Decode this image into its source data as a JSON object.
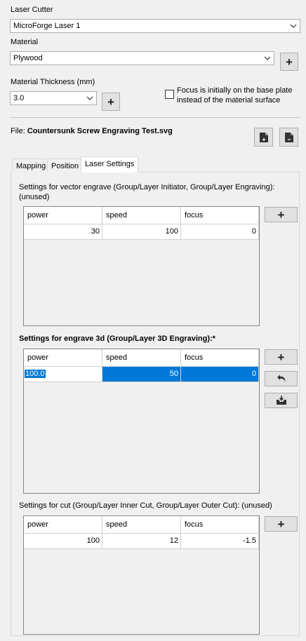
{
  "laser_cutter": {
    "label": "Laser Cutter",
    "value": "MicroForge Laser 1"
  },
  "material": {
    "label": "Material",
    "value": "Plywood"
  },
  "thickness": {
    "label": "Material Thickness (mm)",
    "value": "3.0"
  },
  "focus_option": {
    "line1": "Focus is initially on the base plate",
    "line2": "instead of the material surface",
    "checked": false
  },
  "file": {
    "label": "File:",
    "name": "Countersunk Screw Engraving Test.svg"
  },
  "tabs": [
    {
      "label": "Mapping",
      "active": false
    },
    {
      "label": "Position",
      "active": false
    },
    {
      "label": "Laser Settings",
      "active": true
    }
  ],
  "sections": {
    "vector": {
      "title_line1": "Settings for vector engrave (Group/Layer Initiator, Group/Layer Engraving):",
      "title_line2": "(unused)",
      "columns": [
        "power",
        "speed",
        "focus"
      ],
      "row": [
        "30",
        "100",
        "0"
      ]
    },
    "engrave3d": {
      "title": "Settings for engrave 3d (Group/Layer 3D Engraving):*",
      "columns": [
        "power",
        "speed",
        "focus"
      ],
      "row": [
        "100.0",
        "50",
        "0"
      ]
    },
    "cut": {
      "title": "Settings for cut (Group/Layer Inner Cut, Group/Layer Outer Cut): (unused)",
      "columns": [
        "power",
        "speed",
        "focus"
      ],
      "row": [
        "100",
        "12",
        "-1.5"
      ]
    }
  },
  "icons": {
    "combo_arrow": "chevron-down-icon",
    "add": "plus-icon",
    "undo": "undo-icon",
    "save": "save-icon",
    "new_file": "new-file-icon",
    "remove_file": "remove-file-icon"
  },
  "colors": {
    "selection": "#0078d7",
    "background": "#f0f0f0"
  }
}
